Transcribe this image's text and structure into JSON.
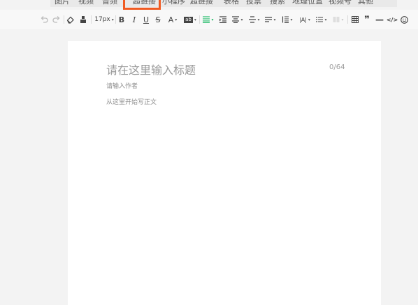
{
  "menubar": {
    "items": [
      "图片",
      "视频",
      "音频",
      "超链接",
      "小程序",
      "超链接",
      "表格",
      "投票",
      "搜索",
      "地理位置",
      "视频号",
      "其他"
    ]
  },
  "toolbar": {
    "font_size": "17px",
    "bold": "B",
    "italic": "I",
    "underline": "U",
    "strike": "S",
    "font_color": "A",
    "bg_color": "ab",
    "letter_spacing": "|A|",
    "quote": "❞",
    "hr": "—",
    "code": "</>",
    "emoji": "☺",
    "colors": {
      "accent": "#2fbf71",
      "highlight_frame": "#f05a22"
    }
  },
  "editor": {
    "title_placeholder": "请在这里输入标题",
    "title_counter": "0/64",
    "author_placeholder": "请输入作者",
    "body_placeholder": "从这里开始写正文"
  }
}
